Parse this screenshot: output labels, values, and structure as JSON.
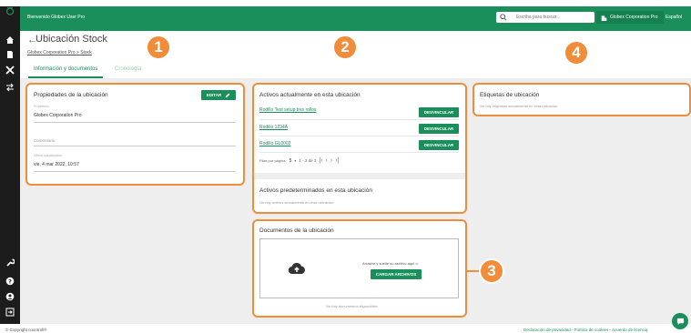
{
  "topbar": {
    "welcome": "Bienvenido Globex User Pro",
    "search_placeholder": "Escriba para buscar...",
    "company": "Globex Corporation Pro",
    "language": "Español"
  },
  "header": {
    "title": "Ubicación Stock",
    "breadcrumb": "Globex Corporation Pro > Stock",
    "tabs": [
      {
        "label": "Información y documentos",
        "active": true
      },
      {
        "label": "Cronología",
        "active": false
      }
    ]
  },
  "properties": {
    "title": "Propiedades de la ubicación",
    "edit_label": "EDITAR",
    "owner_label": "Propietario",
    "owner_value": "Globex Corporation Pro",
    "comment_placeholder": "Comentario",
    "updated_label": "Última actualización",
    "updated_value": "vie, 4 mar 2022, 10:57"
  },
  "assets": {
    "title": "Activos actualmente en esta ubicación",
    "items": [
      {
        "name": "Rodillo Test setup tres rollos",
        "action": "DESVINCULAR"
      },
      {
        "name": "Rodillo 1234A",
        "action": "DESVINCULAR"
      },
      {
        "name": "Rodillo GL0002",
        "action": "DESVINCULAR"
      }
    ],
    "rows_per_page_label": "Filas por página:",
    "rows_per_page_value": "5",
    "range": "1 - 3 de 3"
  },
  "default_assets": {
    "title": "Activos predeterminados en esta ubicación",
    "empty": "No hay activos actualmente en esta ubicación"
  },
  "documents": {
    "title": "Documentos de la ubicación",
    "drop_text": "Arrastre y suelte su archivo aquí o",
    "upload_label": "CARGAR ARCHIVOS",
    "empty": "No hay documentos disponibles"
  },
  "tags": {
    "title": "Etiquetas de ubicación",
    "empty": "No hay etiquetas actualmente en esta ubicación"
  },
  "badges": [
    "1",
    "2",
    "3",
    "4"
  ],
  "footer": {
    "copyright": "© Copyright countroll®",
    "legal": "Declaración de privacidad - Política de cookies - Acuerdo de licencia"
  },
  "colors": {
    "brand": "#1a8f5c",
    "highlight": "#f08c3a",
    "sidebar": "#1c1c1c"
  }
}
